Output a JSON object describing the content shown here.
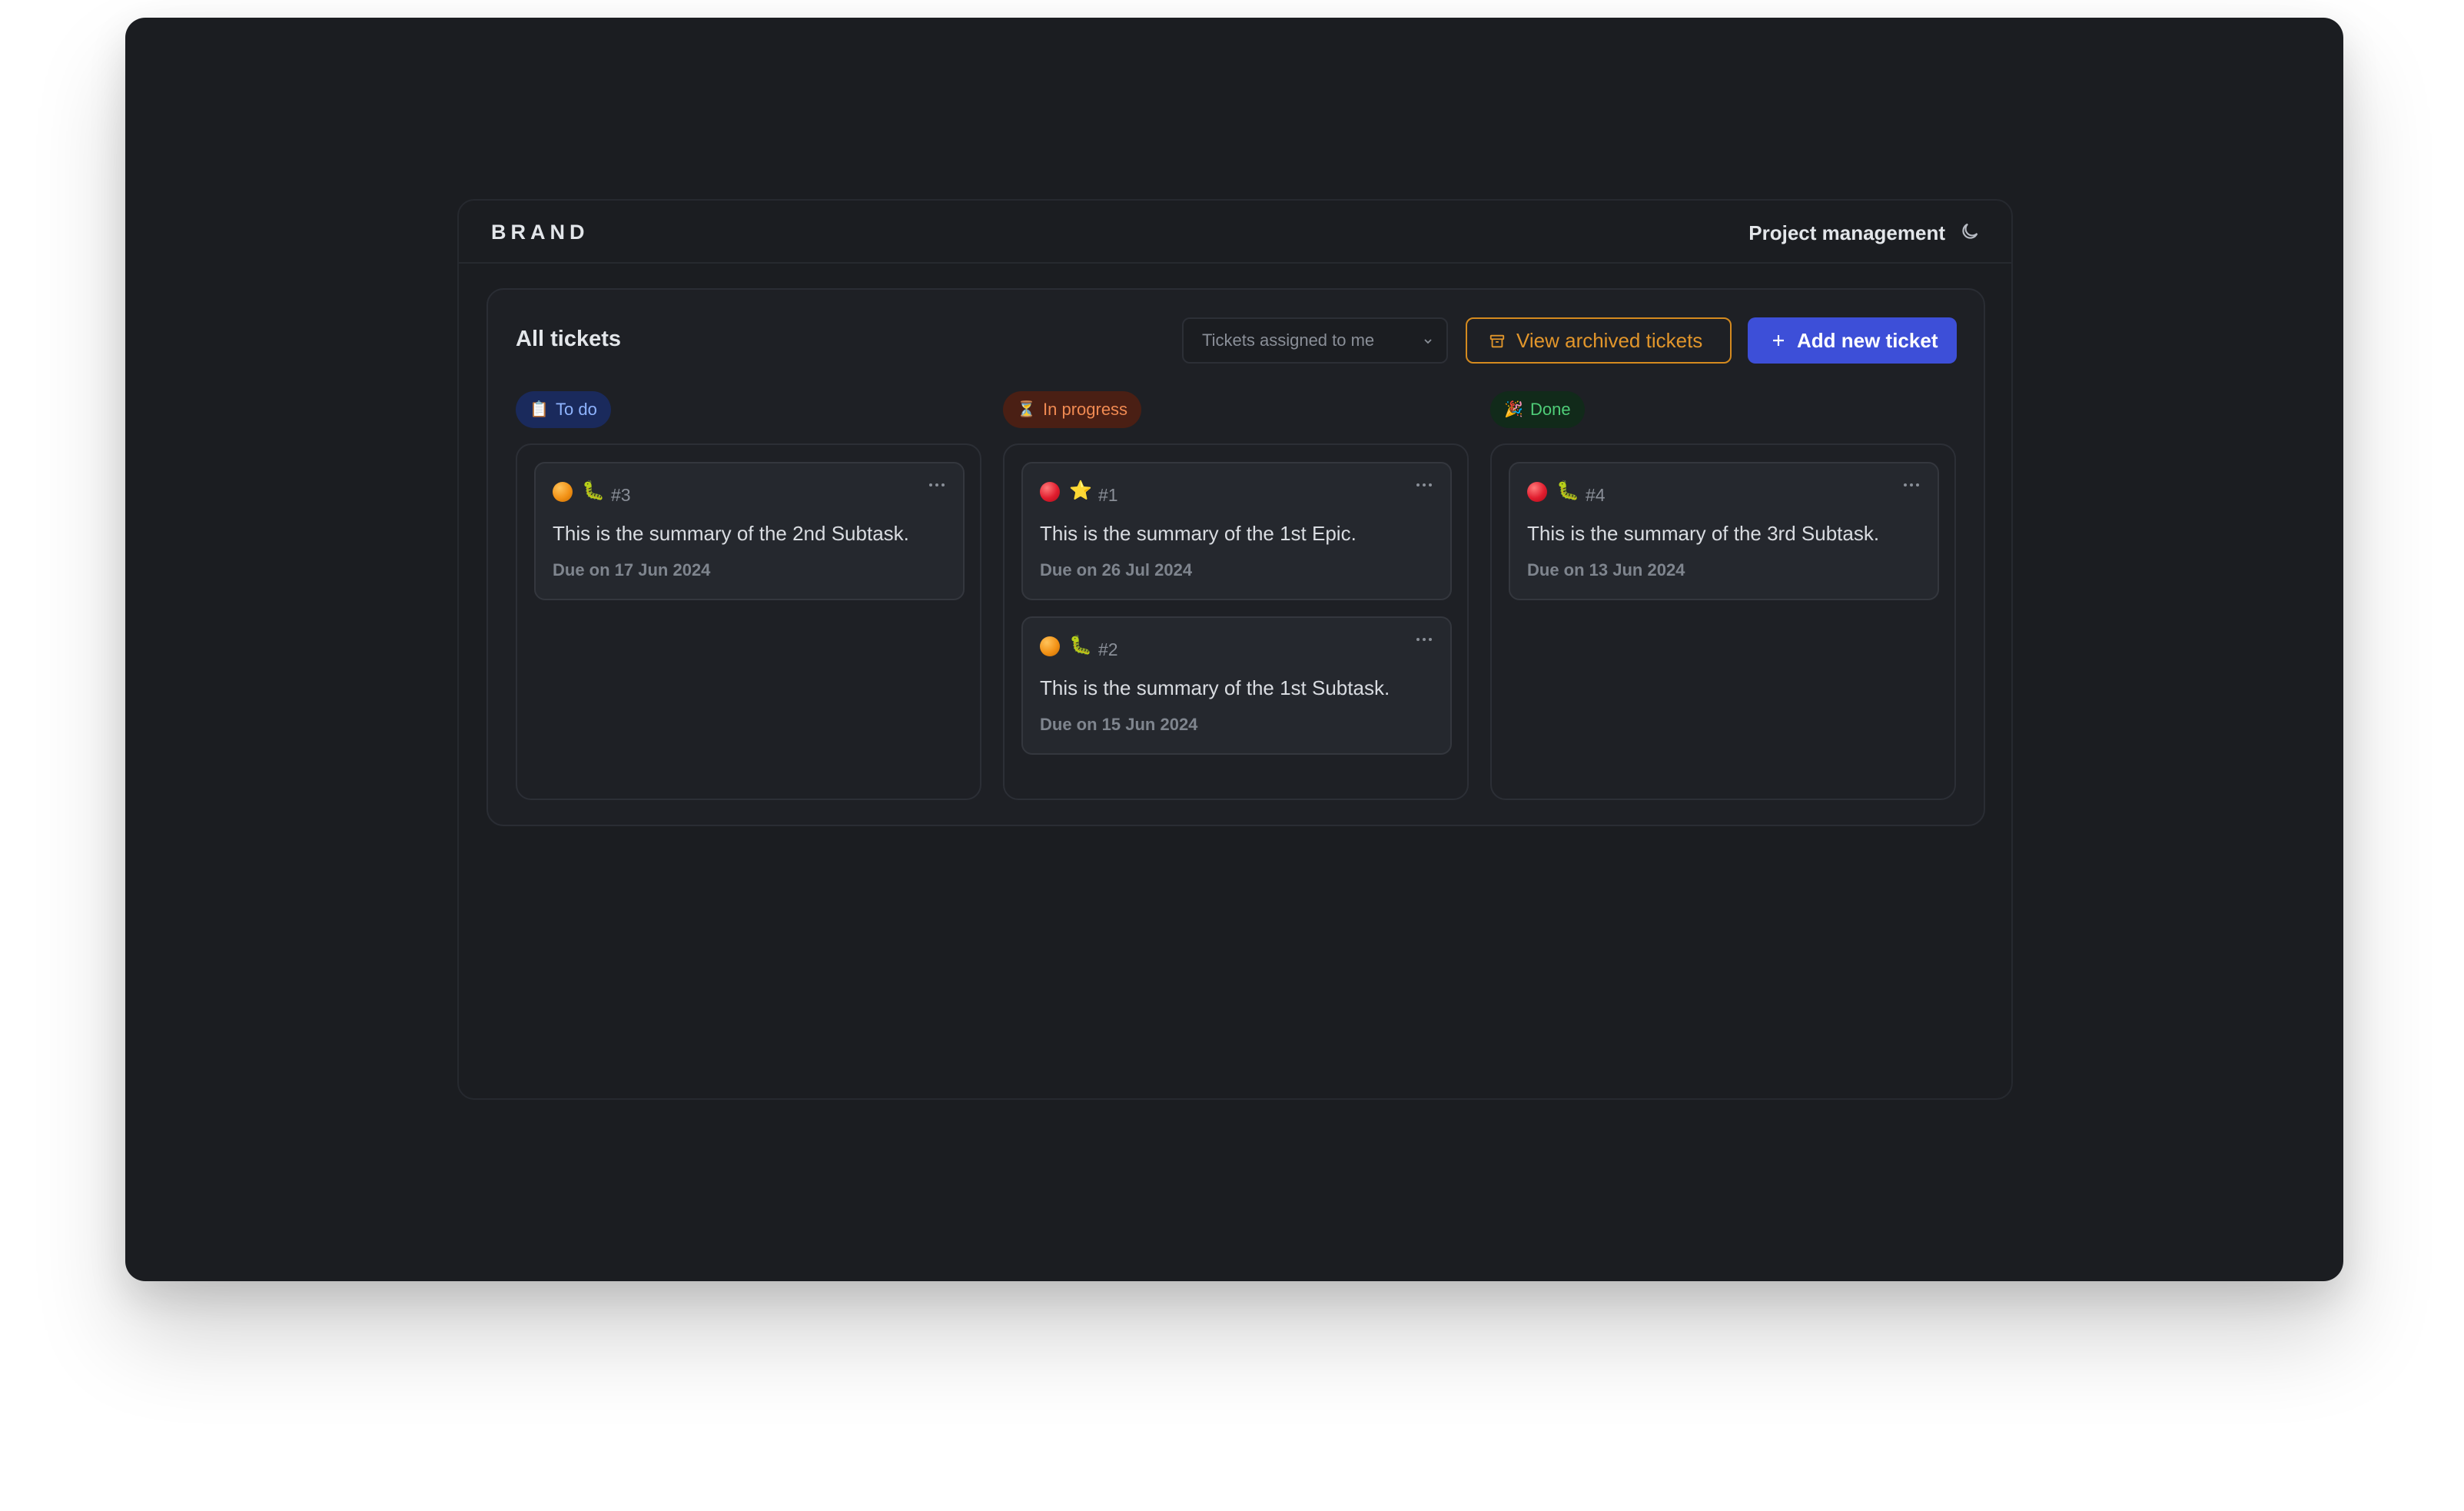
{
  "header": {
    "brand": "BRAND",
    "project": "Project management",
    "theme_icon": "moon-icon"
  },
  "board": {
    "title": "All tickets",
    "filter": {
      "selected": "Tickets assigned to me"
    },
    "archive_button": "View archived tickets",
    "add_button": "Add new ticket",
    "colors": {
      "accent": "#3d4fd8",
      "archive": "#e2962b"
    }
  },
  "columns": [
    {
      "label": "To do",
      "emoji": "📋",
      "cards": [
        {
          "priority": "orange",
          "type_emoji": "🐛",
          "number": "#3",
          "summary": "This is the summary of the 2nd Subtask.",
          "due": "Due on 17 Jun 2024"
        }
      ]
    },
    {
      "label": "In progress",
      "emoji": "⏳",
      "cards": [
        {
          "priority": "red",
          "type_emoji": "⭐",
          "number": "#1",
          "summary": "This is the summary of the 1st Epic.",
          "due": "Due on 26 Jul 2024"
        },
        {
          "priority": "orange",
          "type_emoji": "🐛",
          "number": "#2",
          "summary": "This is the summary of the 1st Subtask.",
          "due": "Due on 15 Jun 2024"
        }
      ]
    },
    {
      "label": "Done",
      "emoji": "🎉",
      "cards": [
        {
          "priority": "red",
          "type_emoji": "🐛",
          "number": "#4",
          "summary": "This is the summary of the 3rd Subtask.",
          "due": "Due on 13 Jun 2024"
        }
      ]
    }
  ]
}
